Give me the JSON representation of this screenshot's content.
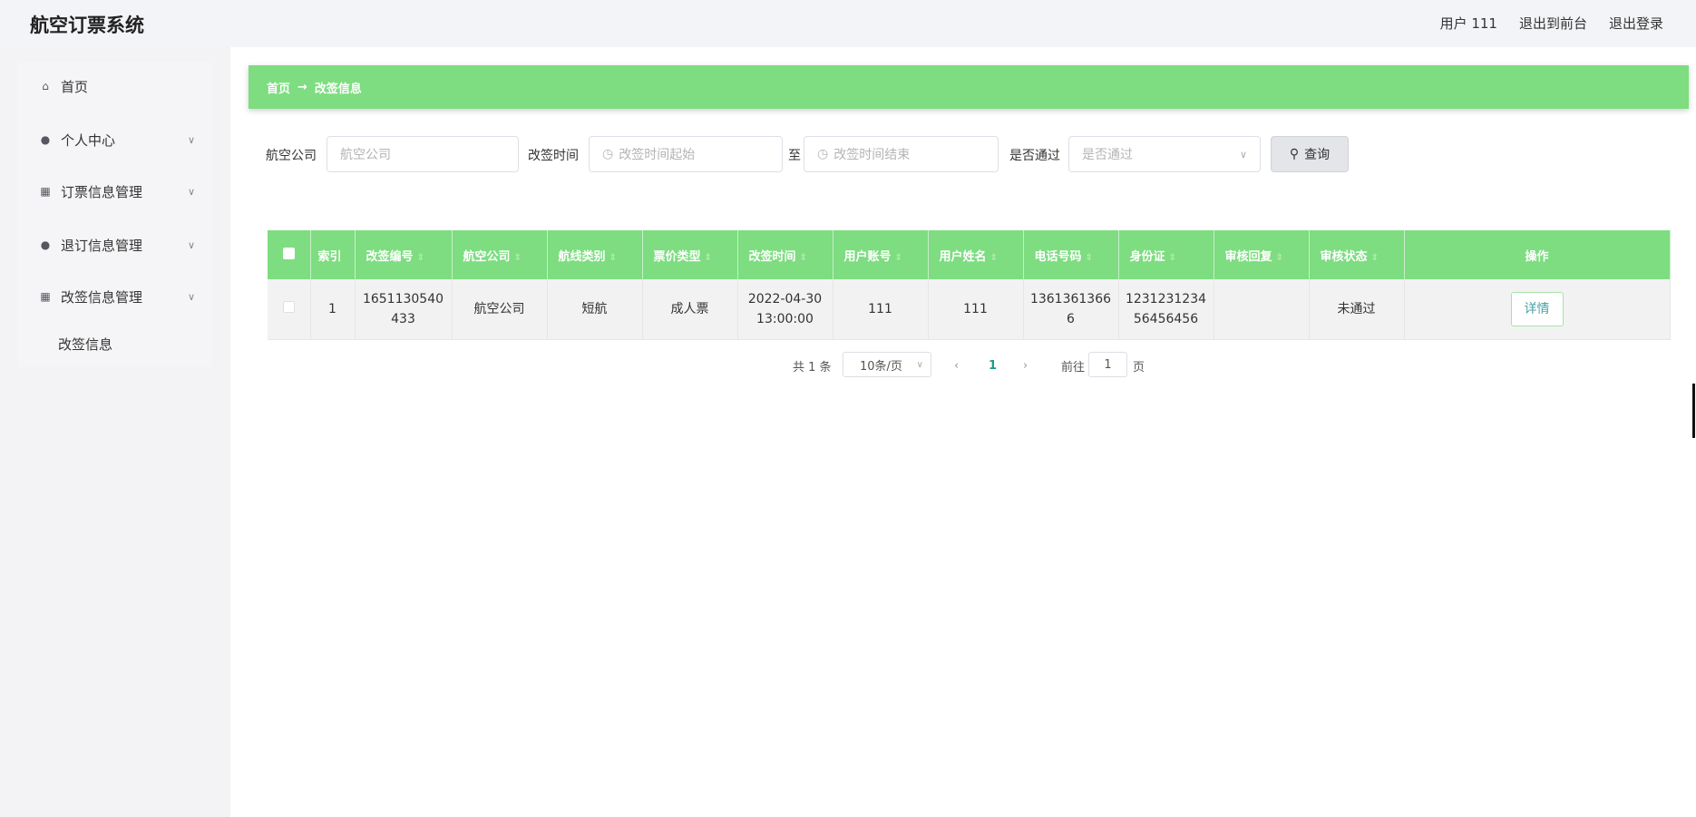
{
  "header": {
    "title": "航空订票系统",
    "user": "用户 111",
    "to_front": "退出到前台",
    "logout": "退出登录"
  },
  "sidebar": {
    "items": [
      {
        "label": "首页",
        "icon": "home-icon"
      },
      {
        "label": "个人中心",
        "icon": "user-icon"
      },
      {
        "label": "订票信息管理",
        "icon": "grid-icon"
      },
      {
        "label": "退订信息管理",
        "icon": "bulb-icon"
      },
      {
        "label": "改签信息管理",
        "icon": "grid-icon"
      }
    ],
    "sub_item": "改签信息"
  },
  "breadcrumb": {
    "home": "首页",
    "arrow": "→",
    "current": "改签信息"
  },
  "search": {
    "airline_label": "航空公司",
    "airline_placeholder": "航空公司",
    "time_label": "改签时间",
    "time_start_placeholder": "改签时间起始",
    "to": "至",
    "time_end_placeholder": "改签时间结束",
    "pass_label": "是否通过",
    "pass_placeholder": "是否通过",
    "query": "查询"
  },
  "table": {
    "headers": [
      "索引",
      "改签编号",
      "航空公司",
      "航线类别",
      "票价类型",
      "改签时间",
      "用户账号",
      "用户姓名",
      "电话号码",
      "身份证",
      "审核回复",
      "审核状态",
      "操作"
    ],
    "rows": [
      {
        "index": "1",
        "no1": "1651130540",
        "no2": "433",
        "airline": "航空公司",
        "route": "短航",
        "fare": "成人票",
        "date": "2022-04-30",
        "time": "13:00:00",
        "account": "111",
        "name": "111",
        "phone1": "1361361366",
        "phone2": "6",
        "id1": "1231231234",
        "id2": "56456456",
        "reply": "",
        "status": "未通过",
        "action": "详情"
      }
    ]
  },
  "pagination": {
    "total": "共 1 条",
    "page_size": "10条/页",
    "current": "1",
    "goto": "前往",
    "goto_value": "1",
    "page_suffix": "页"
  },
  "colors": {
    "accent": "#7ddd80"
  }
}
